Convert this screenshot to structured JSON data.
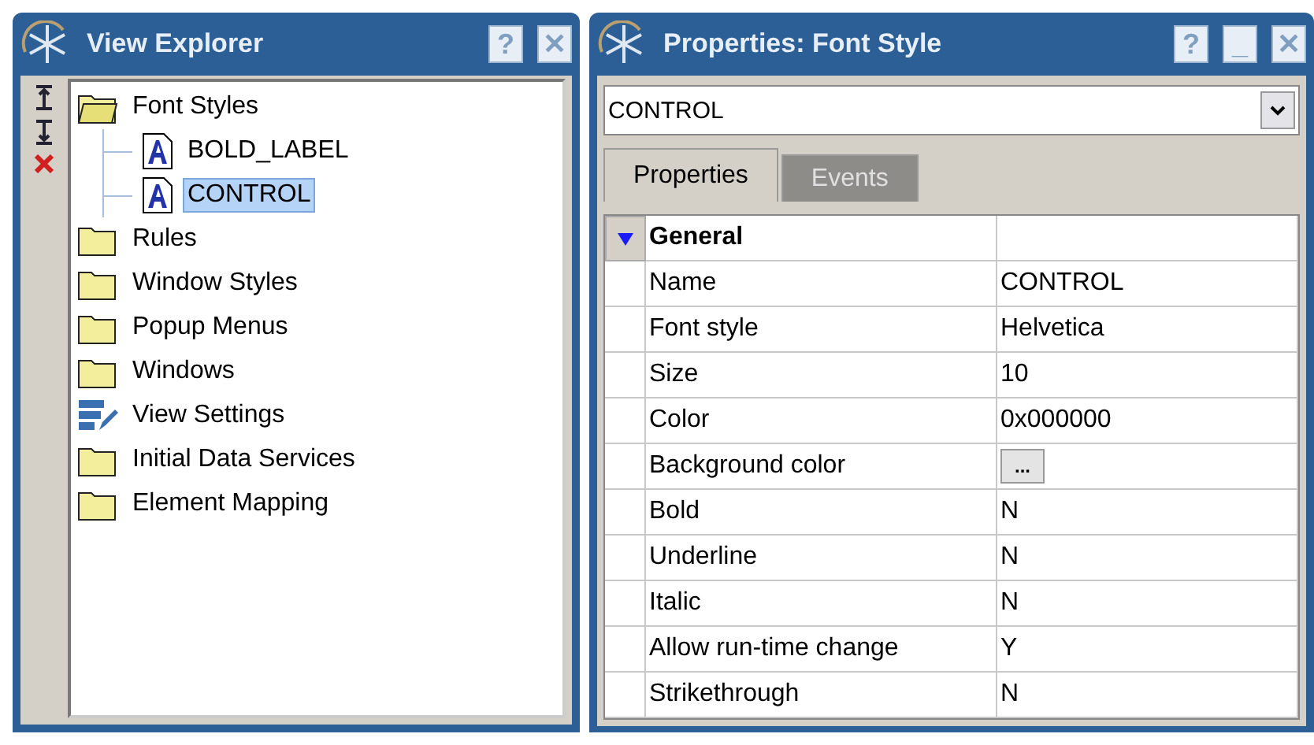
{
  "explorer": {
    "title": "View Explorer",
    "title_buttons": [
      "?",
      "✕"
    ],
    "tools": [
      {
        "kind": "move-top"
      },
      {
        "kind": "move-bottom"
      },
      {
        "kind": "delete"
      }
    ],
    "tree": [
      {
        "label": "Font Styles",
        "kind": "folder",
        "expanded": true,
        "selected": false,
        "children": [
          {
            "label": "BOLD_LABEL",
            "kind": "style",
            "selected": false
          },
          {
            "label": "CONTROL",
            "kind": "style",
            "selected": true
          }
        ]
      },
      {
        "label": "Rules",
        "kind": "folder",
        "expanded": false,
        "selected": false
      },
      {
        "label": "Window Styles",
        "kind": "folder",
        "expanded": false,
        "selected": false
      },
      {
        "label": "Popup Menus",
        "kind": "folder",
        "expanded": false,
        "selected": false
      },
      {
        "label": "Windows",
        "kind": "folder",
        "expanded": false,
        "selected": false
      },
      {
        "label": "View Settings",
        "kind": "settings",
        "selected": false
      },
      {
        "label": "Initial Data Services",
        "kind": "folder",
        "expanded": false,
        "selected": false
      },
      {
        "label": "Element Mapping",
        "kind": "folder",
        "expanded": false,
        "selected": false
      }
    ]
  },
  "properties": {
    "title": "Properties: Font Style",
    "title_buttons": [
      "?",
      "_",
      "✕"
    ],
    "combo_value": "CONTROL",
    "tabs": [
      {
        "label": "Properties",
        "selected": true
      },
      {
        "label": "Events",
        "selected": false
      }
    ],
    "group": {
      "label": "General",
      "expanded": true
    },
    "rows": [
      {
        "name": "Name",
        "value": "CONTROL",
        "kind": "text"
      },
      {
        "name": "Font style",
        "value": "Helvetica",
        "kind": "text"
      },
      {
        "name": "Size",
        "value": "10",
        "kind": "text"
      },
      {
        "name": "Color",
        "value": "0x000000",
        "kind": "text"
      },
      {
        "name": "Background color",
        "value": "",
        "kind": "picker",
        "button": "..."
      },
      {
        "name": "Bold",
        "value": "N",
        "kind": "text"
      },
      {
        "name": "Underline",
        "value": "N",
        "kind": "text"
      },
      {
        "name": "Italic",
        "value": "N",
        "kind": "text"
      },
      {
        "name": "Allow run-time change",
        "value": "Y",
        "kind": "text"
      },
      {
        "name": "Strikethrough",
        "value": "N",
        "kind": "text"
      }
    ]
  }
}
